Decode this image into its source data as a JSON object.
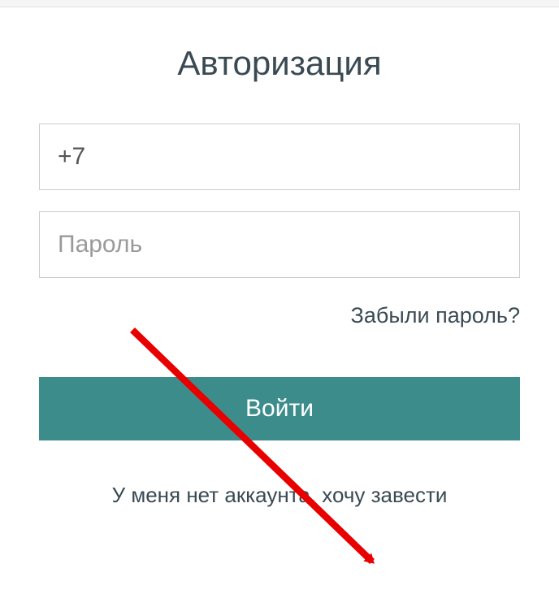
{
  "auth": {
    "title": "Авторизация",
    "phone_value": "+7",
    "password_placeholder": "Пароль",
    "forgot_password": "Забыли пароль?",
    "login_button": "Войти",
    "register_link": "У меня нет аккаунта, хочу завести"
  },
  "colors": {
    "primary": "#3d8c8c",
    "text_dark": "#3a4a52",
    "placeholder": "#9a9a9a",
    "border": "#cccccc",
    "arrow": "#e80000"
  }
}
